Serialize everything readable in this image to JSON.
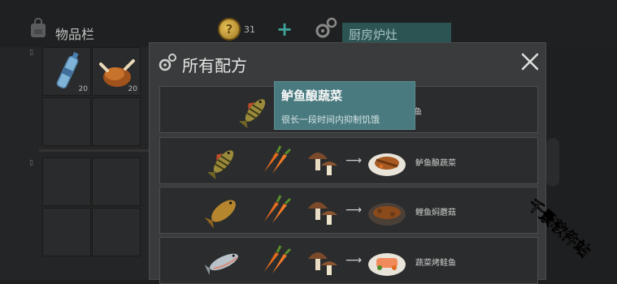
{
  "inventory": {
    "title": "物品栏",
    "slots": [
      {
        "item": "water-bottle",
        "qty": "20"
      },
      {
        "item": "roast-chicken",
        "qty": "20"
      }
    ]
  },
  "currency": {
    "count": "31",
    "plus": "+",
    "coin_glyph": "?"
  },
  "station": {
    "name": "厨房炉灶"
  },
  "modal": {
    "title": "所有配方",
    "close": "✕"
  },
  "tooltip": {
    "title": "鲈鱼酿蔬菜",
    "description": "很长一段时间内抑制饥饿"
  },
  "recipes": [
    {
      "ingredients": [
        "perch-fish"
      ],
      "result_name": "鱼"
    },
    {
      "ingredients": [
        "perch-fish",
        "carrot",
        "mushroom"
      ],
      "arrow": "⟶",
      "result_name": "鲈鱼酿蔬菜"
    },
    {
      "ingredients": [
        "carp-fish",
        "carrot",
        "mushroom"
      ],
      "arrow": "⟶",
      "result_name": "鲤鱼焖蘑菇"
    },
    {
      "ingredients": [
        "salmon-fish",
        "carrot",
        "mushroom"
      ],
      "arrow": "⟶",
      "result_name": "蔬菜烤鲑鱼"
    }
  ],
  "watermark": "千景软件站",
  "colors": {
    "accent_teal": "#2c5453",
    "tooltip_bg": "#4a7d82",
    "plus_teal": "#3fa39a"
  }
}
